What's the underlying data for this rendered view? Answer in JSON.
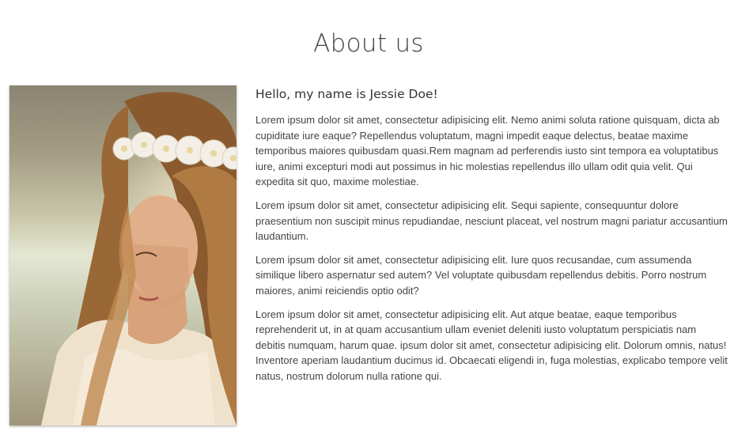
{
  "page": {
    "title": "About us"
  },
  "profile": {
    "greeting": "Hello, my name is Jessie Doe!",
    "paragraphs": [
      "Lorem ipsum dolor sit amet, consectetur adipisicing elit. Nemo animi soluta ratione quisquam, dicta ab cupiditate iure eaque? Repellendus voluptatum, magni impedit eaque delectus, beatae maxime temporibus maiores quibusdam quasi.Rem magnam ad perferendis iusto sint tempora ea voluptatibus iure, animi excepturi modi aut possimus in hic molestias repellendus illo ullam odit quia velit. Qui expedita sit quo, maxime molestiae.",
      "Lorem ipsum dolor sit amet, consectetur adipisicing elit. Sequi sapiente, consequuntur dolore praesentium non suscipit minus repudiandae, nesciunt placeat, vel nostrum magni pariatur accusantium laudantium.",
      "Lorem ipsum dolor sit amet, consectetur adipisicing elit. Iure quos recusandae, cum assumenda similique libero aspernatur sed autem? Vel voluptate quibusdam repellendus debitis. Porro nostrum maiores, animi reiciendis optio odit?",
      "Lorem ipsum dolor sit amet, consectetur adipisicing elit. Aut atque beatae, eaque temporibus reprehenderit ut, in at quam accusantium ullam eveniet deleniti iusto voluptatum perspiciatis nam debitis numquam, harum quae. ipsum dolor sit amet, consectetur adipisicing elit. Dolorum omnis, natus! Inventore aperiam laudantium ducimus id. Obcaecati eligendi in, fuga molestias, explicabo tempore velit natus, nostrum dolorum nulla ratione qui."
    ]
  },
  "colors": {
    "text": "#444444",
    "heading": "#444444",
    "background": "#ffffff"
  }
}
